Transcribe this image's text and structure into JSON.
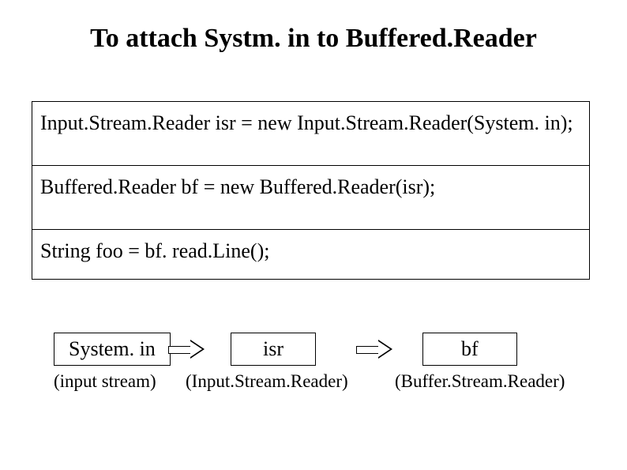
{
  "title": "To attach Systm. in to Buffered.Reader",
  "code": {
    "line1": "Input.Stream.Reader isr = new Input.Stream.Reader(System. in);",
    "line2": "Buffered.Reader bf = new Buffered.Reader(isr);",
    "line3": "String foo = bf. read.Line();"
  },
  "diagram": {
    "node1": {
      "label": "System. in",
      "sub": "(input stream)"
    },
    "node2": {
      "label": "isr",
      "sub": "(Input.Stream.Reader)"
    },
    "node3": {
      "label": "bf",
      "sub": "(Buffer.Stream.Reader)"
    }
  }
}
